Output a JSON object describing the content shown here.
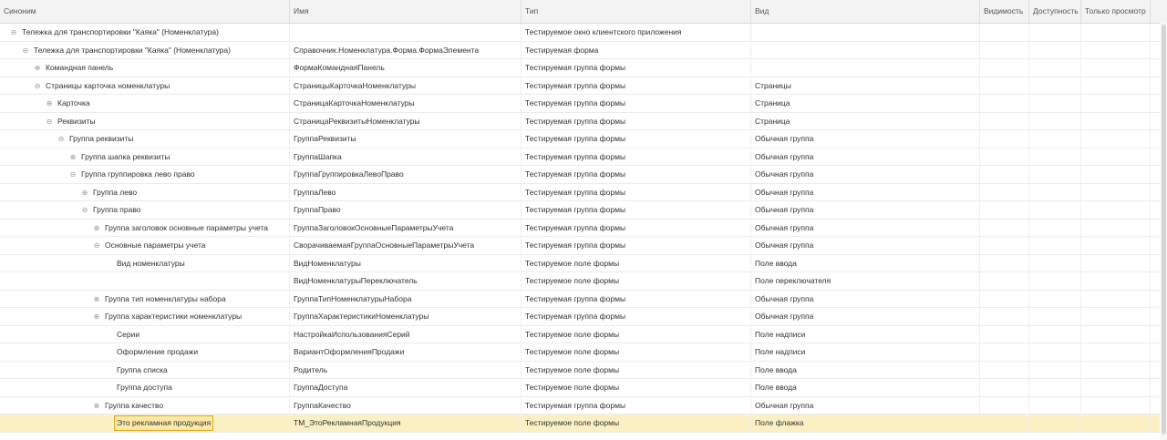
{
  "columns": {
    "synonym": "Синоним",
    "name": "Имя",
    "type": "Тип",
    "view": "Вид",
    "visibility": "Видимость",
    "availability": "Доступность",
    "readonly": "Только просмотр"
  },
  "rows": [
    {
      "level": 0,
      "toggle": "⊖",
      "synonym": "Тележка для транспортировки \"Каяка\" (Номенклатура)",
      "name": "",
      "type": "Тестируемое окно клиентского приложения",
      "view": ""
    },
    {
      "level": 1,
      "toggle": "⊖",
      "synonym": "Тележка для транспортировки \"Каяка\" (Номенклатура)",
      "name": "Справочник.Номенклатура.Форма.ФормаЭлемента",
      "type": "Тестируемая форма",
      "view": ""
    },
    {
      "level": 2,
      "toggle": "⊕",
      "synonym": "Командная панель",
      "name": "ФормаКоманднаяПанель",
      "type": "Тестируемая группа формы",
      "view": ""
    },
    {
      "level": 2,
      "toggle": "⊖",
      "synonym": "Страницы карточка номенклатуры",
      "name": "СтраницыКарточкаНоменклатуры",
      "type": "Тестируемая группа формы",
      "view": "Страницы"
    },
    {
      "level": 3,
      "toggle": "⊕",
      "synonym": "Карточка",
      "name": "СтраницаКарточкаНоменклатуры",
      "type": "Тестируемая группа формы",
      "view": "Страница"
    },
    {
      "level": 3,
      "toggle": "⊖",
      "synonym": "Реквизиты",
      "name": "СтраницаРеквизитыНоменклатуры",
      "type": "Тестируемая группа формы",
      "view": "Страница"
    },
    {
      "level": 4,
      "toggle": "⊖",
      "synonym": "Группа реквизиты",
      "name": "ГруппаРеквизиты",
      "type": "Тестируемая группа формы",
      "view": "Обычная группа"
    },
    {
      "level": 5,
      "toggle": "⊕",
      "synonym": "Группа шапка реквизиты",
      "name": "ГруппаШапка",
      "type": "Тестируемая группа формы",
      "view": "Обычная группа"
    },
    {
      "level": 5,
      "toggle": "⊖",
      "synonym": "Группа группировка лево право",
      "name": "ГруппаГруппировкаЛевоПраво",
      "type": "Тестируемая группа формы",
      "view": "Обычная группа"
    },
    {
      "level": 6,
      "toggle": "⊕",
      "synonym": "Группа лево",
      "name": "ГруппаЛево",
      "type": "Тестируемая группа формы",
      "view": "Обычная группа"
    },
    {
      "level": 6,
      "toggle": "⊖",
      "synonym": "Группа право",
      "name": "ГруппаПраво",
      "type": "Тестируемая группа формы",
      "view": "Обычная группа"
    },
    {
      "level": 7,
      "toggle": "⊕",
      "synonym": "Группа заголовок основные параметры учета",
      "name": "ГруппаЗаголовокОсновныеПараметрыУчета",
      "type": "Тестируемая группа формы",
      "view": "Обычная группа"
    },
    {
      "level": 7,
      "toggle": "⊖",
      "synonym": "Основные параметры учета",
      "name": "СворачиваемаяГруппаОсновныеПараметрыУчета",
      "type": "Тестируемая группа формы",
      "view": "Обычная группа"
    },
    {
      "level": 8,
      "toggle": "",
      "synonym": "Вид номенклатуры",
      "name": "ВидНоменклатуры",
      "type": "Тестируемое поле формы",
      "view": "Поле ввода"
    },
    {
      "level": 8,
      "toggle": "",
      "synonym": "",
      "name": "ВидНоменклатурыПереключатель",
      "type": "Тестируемое поле формы",
      "view": "Поле переключателя"
    },
    {
      "level": 7,
      "toggle": "⊕",
      "synonym": "Группа тип номенклатуры набора",
      "name": "ГруппаТипНоменклатурыНабора",
      "type": "Тестируемая группа формы",
      "view": "Обычная группа"
    },
    {
      "level": 7,
      "toggle": "⊕",
      "synonym": "Группа характеристики номенклатуры",
      "name": "ГруппаХарактеристикиНоменклатуры",
      "type": "Тестируемая группа формы",
      "view": "Обычная группа"
    },
    {
      "level": 8,
      "toggle": "",
      "synonym": "Серии",
      "name": "НастройкаИспользованияСерий",
      "type": "Тестируемое поле формы",
      "view": "Поле надписи"
    },
    {
      "level": 8,
      "toggle": "",
      "synonym": "Оформление продажи",
      "name": "ВариантОформленияПродажи",
      "type": "Тестируемое поле формы",
      "view": "Поле надписи"
    },
    {
      "level": 8,
      "toggle": "",
      "synonym": "Группа списка",
      "name": "Родитель",
      "type": "Тестируемое поле формы",
      "view": "Поле ввода"
    },
    {
      "level": 8,
      "toggle": "",
      "synonym": "Группа доступа",
      "name": "ГруппаДоступа",
      "type": "Тестируемое поле формы",
      "view": "Поле ввода"
    },
    {
      "level": 7,
      "toggle": "⊕",
      "synonym": "Группа качество",
      "name": "ГруппаКачество",
      "type": "Тестируемая группа формы",
      "view": "Обычная группа"
    },
    {
      "level": 8,
      "toggle": "",
      "synonym": "Это рекламная продукция",
      "name": "ТМ_ЭтоРекламнаяПродукция",
      "type": "Тестируемое поле формы",
      "view": "Поле флажка",
      "selected": true
    }
  ],
  "colors": {
    "header_bg": "#f3f3f3",
    "selected_row": "#fbf0c4",
    "current_cell_border": "#e5a818"
  }
}
